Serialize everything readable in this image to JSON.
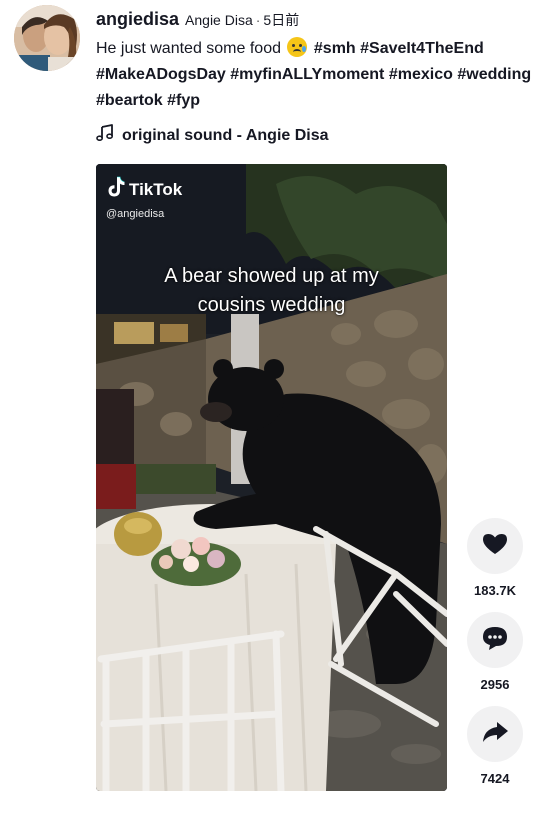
{
  "author": {
    "username": "angiedisa",
    "nickname": "Angie Disa",
    "separator": "·",
    "posted": "5日前"
  },
  "caption": {
    "line1_text": "He just wanted some food ",
    "line1_emoji": "sad-tear-emoji",
    "line1_tags": [
      "#smh",
      "#SaveIt4TheEnd"
    ],
    "line2_tags": [
      "#MakeADogsDay",
      "#myfinALLYmoment",
      "#mexico",
      "#wedding"
    ],
    "line3_tags": [
      "#beartok",
      "#fyp"
    ]
  },
  "sound": {
    "icon": "music-note-icon",
    "label": "original sound - Angie Disa"
  },
  "video": {
    "watermark_brand": "TikTok",
    "watermark_handle": "@angiedisa",
    "overlay_line1": "A bear showed up at my",
    "overlay_line2": "cousins wedding"
  },
  "actions": {
    "like_count": "183.7K",
    "comment_count": "2956",
    "share_count": "7424"
  },
  "colors": {
    "text": "#161823",
    "action_bg": "#f1f1f2",
    "icon": "#161823"
  }
}
